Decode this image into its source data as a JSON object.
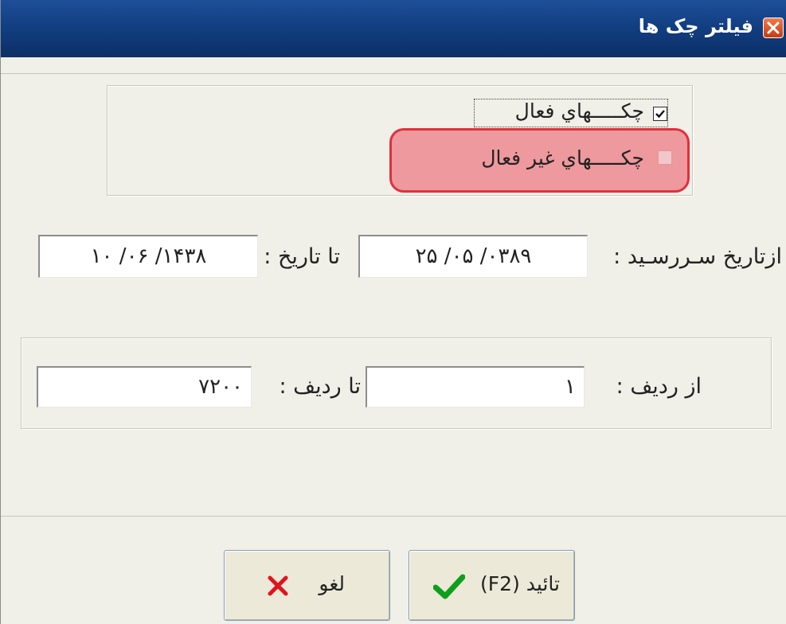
{
  "window": {
    "title": "فیلتر چک ها"
  },
  "status_filter": {
    "items": [
      {
        "label": "چکـــــهاي فعال",
        "checked": true
      },
      {
        "label": "چکـــــهاي غیر فعال",
        "checked": false,
        "highlighted": true
      }
    ]
  },
  "due_date": {
    "from_label": "ازتاریخ سـررسـید :",
    "from_value": "۰۳۸۹/ ۰۵/ ۲۵",
    "to_label": "تا تاریخ :",
    "to_value": "۱۴۳۸/ ۰۶/ ۱۰"
  },
  "row_range": {
    "from_label": "از ردیف :",
    "from_value": "۱",
    "to_label": "تا ردیف :",
    "to_value": "۷۲۰۰"
  },
  "buttons": {
    "confirm_label": "تائید (F2)",
    "cancel_label": "لغو"
  },
  "colors": {
    "titlebar": "#123f82",
    "highlight_border": "#e0303b",
    "highlight_fill": "#ec8f96",
    "check_green": "#0e9f1c",
    "cancel_red": "#e1141e"
  },
  "icons": {
    "close": "close-icon",
    "check": "checkmark-icon",
    "confirm": "green-checkmark-icon",
    "cancel": "red-x-icon"
  }
}
